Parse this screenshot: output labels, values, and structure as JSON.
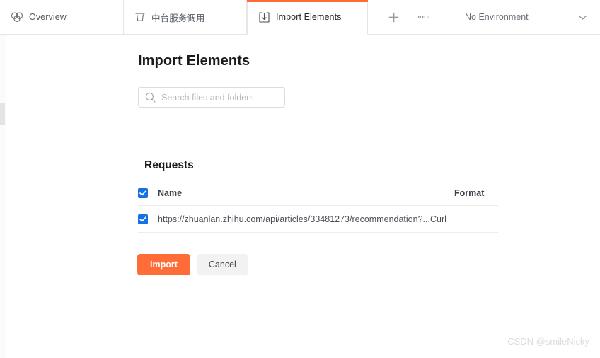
{
  "tabbar": {
    "tabs": [
      {
        "id": "overview",
        "label": "Overview",
        "icon": "postman-overview-icon",
        "active": false
      },
      {
        "id": "service",
        "label": "中台服务调用",
        "icon": "trash-icon",
        "active": false
      },
      {
        "id": "import",
        "label": "Import Elements",
        "icon": "import-arrow-icon",
        "active": true
      }
    ],
    "new_tab_icon": "plus-icon",
    "more_icon": "more-horizontal-icon",
    "environment": {
      "label": "No Environment",
      "chevron_icon": "chevron-down-icon"
    },
    "active_tab_accent": "#ff6c37"
  },
  "main": {
    "page_title": "Import Elements",
    "search": {
      "icon": "search-icon",
      "value": "",
      "placeholder": "Search files and folders"
    },
    "requests": {
      "section_title": "Requests",
      "select_all_checked": true,
      "columns": {
        "name": "Name",
        "format": "Format"
      },
      "rows": [
        {
          "checked": true,
          "name": "https://zhuanlan.zhihu.com/api/articles/33481273/recommendation?...",
          "format": "Curl"
        }
      ],
      "checkbox_color": "#1472e6"
    },
    "actions": {
      "import_label": "Import",
      "cancel_label": "Cancel",
      "import_color": "#ff6c37",
      "cancel_color": "#f2f2f2"
    }
  },
  "watermark": {
    "text": "CSDN @smileNicky"
  }
}
